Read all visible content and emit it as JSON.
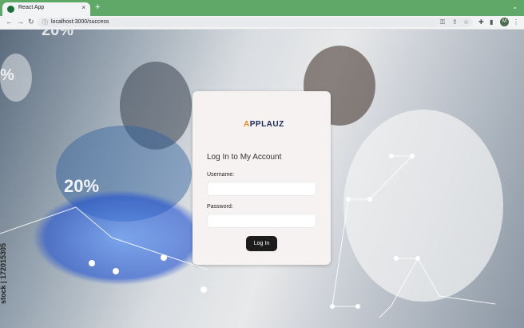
{
  "browser": {
    "tab_title": "React App",
    "tab_close": "×",
    "new_tab": "+",
    "tabs_menu": "⌄",
    "back": "←",
    "forward": "→",
    "reload": "↻",
    "url": "localhost:3000/success",
    "profile_initials": "M",
    "more": "⋮"
  },
  "background": {
    "stat_left": "20%",
    "stat_top": "20%",
    "stat_edge": "%",
    "watermark": "stock | 172015305"
  },
  "login": {
    "logo_a": "A",
    "logo_rest": "PPLAUZ",
    "heading": "Log In to My Account",
    "username_label": "Username:",
    "username_value": "",
    "password_label": "Password:",
    "password_value": "",
    "submit_label": "Log In"
  }
}
